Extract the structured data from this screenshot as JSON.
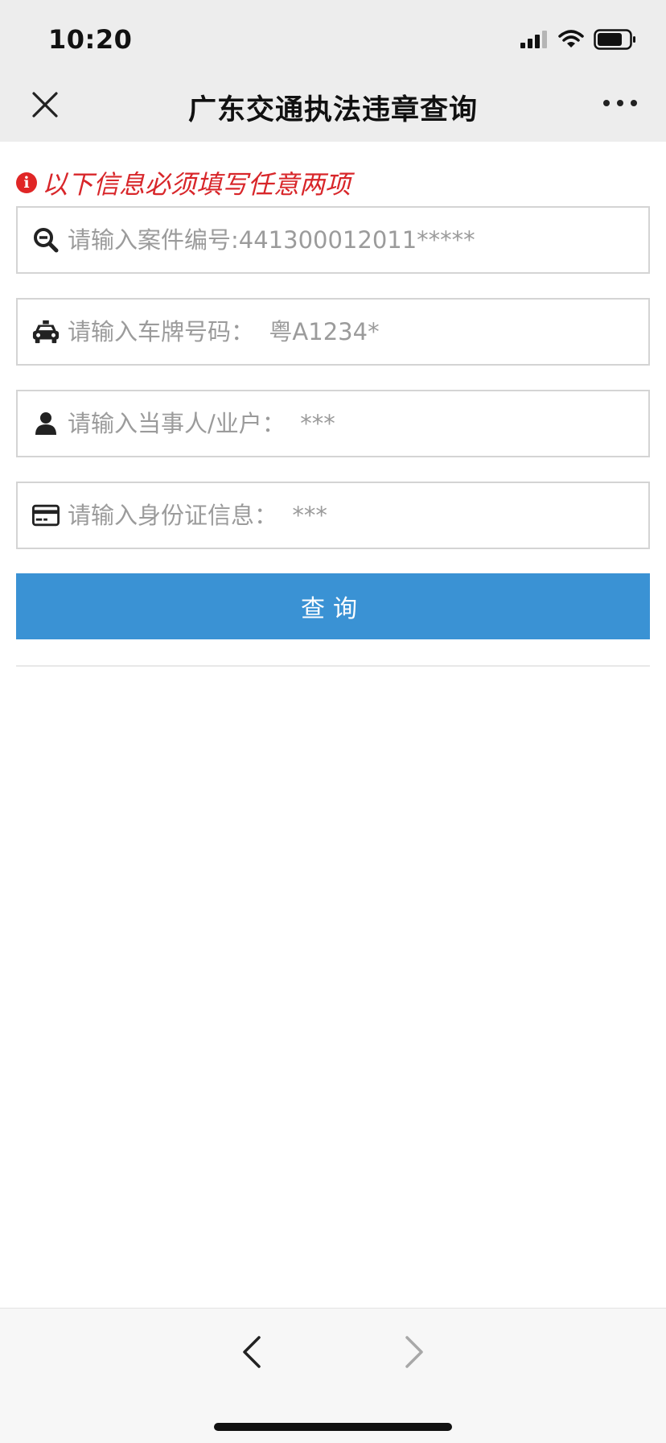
{
  "status_bar": {
    "time": "10:20"
  },
  "nav": {
    "title": "广东交通执法违章查询"
  },
  "notice": {
    "text": "以下信息必须填写任意两项",
    "icon": "info-circle-icon",
    "color": "#d8262a"
  },
  "fields": {
    "case_number": {
      "placeholder": "请输入案件编号:441300012011*****",
      "value": "",
      "icon": "search-minus-icon"
    },
    "plate_number": {
      "placeholder": "请输入车牌号码：  粤A1234*",
      "value": "",
      "icon": "car-icon"
    },
    "party_name": {
      "placeholder": "请输入当事人/业户：  ***",
      "value": "",
      "icon": "user-icon"
    },
    "id_card": {
      "placeholder": "请输入身份证信息：  ***",
      "value": "",
      "icon": "credit-card-icon"
    }
  },
  "search_button": {
    "label": "查询",
    "color": "#3a92d4"
  },
  "bottom_bar": {
    "back_icon": "chevron-left-icon",
    "forward_icon": "chevron-right-icon"
  }
}
